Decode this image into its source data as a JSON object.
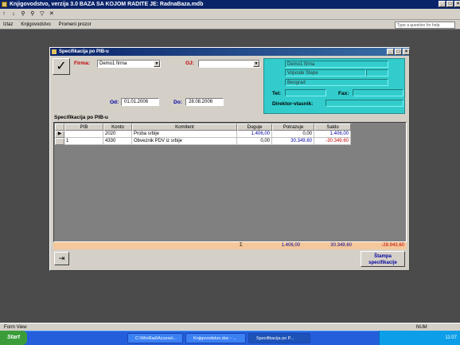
{
  "app": {
    "title": "Knjigovodstvo, verzija 3.0    BAZA SA KOJOM RADITE JE: RadnaBaza.mdb"
  },
  "menu": {
    "items": [
      "Izlaz",
      "Knjigovodstvo",
      "Promeni prozor"
    ],
    "help_placeholder": "Type a question for help"
  },
  "form": {
    "title": "Specifikacija po PIB-u",
    "firma_label": "Firma:",
    "firma_value": "Demo1 firma",
    "oj_label": "OJ:",
    "oj_value": "",
    "od_label": "Od:",
    "od_value": "01.01.2006",
    "do_label": "Do:",
    "do_value": "28.08.2006",
    "company": {
      "name": "Demo1 firma",
      "address": "Vojvode Stepe",
      "city": "Beograd",
      "tel_label": "Tel:",
      "tel_value": "",
      "fax_label": "Fax:",
      "fax_value": "",
      "director_label": "Direktor-vlasnik:",
      "director_value": ""
    },
    "section_label": "Specifikacija po PIB-u",
    "columns": [
      "PIB",
      "Konto",
      "Komitent",
      "Duguje",
      "Potrazuje",
      "Saldo"
    ],
    "rows": [
      {
        "pib": "",
        "konto": "2020",
        "komitent": "Proba srbije",
        "duguje": "1.406,00",
        "potrazuje": "0,00",
        "saldo": "1.406,00"
      },
      {
        "pib": "1",
        "konto": "4330",
        "komitent": "Obveznik PDV iz srbije",
        "duguje": "0,00",
        "potrazuje": "30.349,60",
        "saldo": "-30.349,60"
      }
    ],
    "totals": {
      "sigma": "Σ",
      "duguje": "1.406,00",
      "potrazuje": "30.349,60",
      "saldo": "-28.943,60"
    },
    "print_button": "Štampa specifikacije"
  },
  "status": {
    "left": "Form View",
    "right": "NUM"
  },
  "taskbar": {
    "start": "Start",
    "tasks": [
      "C:\\WinRad\\Access\\...",
      "Knjigovodstvo.doc - ...",
      "Specifikacija po P..."
    ],
    "clock": "11:07"
  },
  "colors": {
    "title_bar": "#0a246a",
    "teal_panel": "#33cccc",
    "totals_bg": "#f4c89a",
    "negative": "#c00000"
  }
}
